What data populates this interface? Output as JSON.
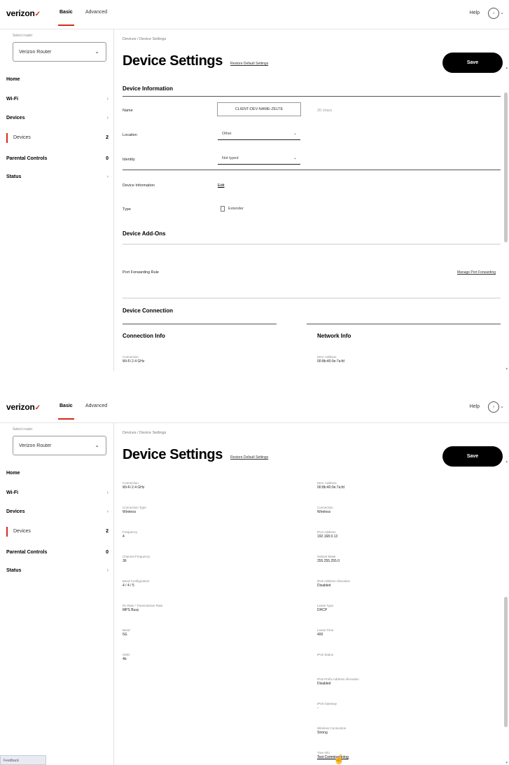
{
  "topbar": {
    "logo": "verizon",
    "logo_check": "✓",
    "tabs": [
      {
        "label": "Basic"
      },
      {
        "label": "Advanced"
      }
    ],
    "help": "Help",
    "avatar_icon": "person-circle-icon"
  },
  "sidebar": {
    "select_label": "Select router",
    "select_value": "Verizon Router",
    "items": [
      {
        "label": "Home",
        "right": ""
      },
      {
        "label": "Wi-Fi",
        "right": "›"
      },
      {
        "label": "Devices",
        "right": "›"
      },
      {
        "label": "Devices",
        "right": "2"
      },
      {
        "label": "Parental Controls",
        "right": "0"
      },
      {
        "label": "Status",
        "right": "›"
      }
    ]
  },
  "main": {
    "breadcrumb": "Devices  /  Device Settings",
    "title": "Device Settings",
    "restore_link": "Restore Default Settings",
    "save_label": "Save"
  },
  "device_info": {
    "heading": "Device Information",
    "name_label": "Name",
    "name_value": "CLIENT-DEV-NAME-ZELTE",
    "name_hint": "20 chars",
    "location_label": "Location",
    "location_value": "Other",
    "identity_label": "Identity",
    "identity_value": "Not typed",
    "device_info_label": "Device Information",
    "device_info_link": "Edit",
    "type_label": "Type",
    "type_check_label": "Extender"
  },
  "addons": {
    "heading": "Device Add-Ons",
    "port_forwarding_label": "Port Forwarding Rule",
    "manage_link": "Manage Port Forwarding"
  },
  "connection": {
    "heading": "Device Connection",
    "conn_info_heading": "Connection Info",
    "net_info_heading": "Network Info",
    "left_fields": [
      {
        "label": "Connection",
        "value": "Wi-Fi 2.4 GHz"
      },
      {
        "label": "Connection Type",
        "value": "Wireless"
      },
      {
        "label": "Frequency",
        "value": "4"
      },
      {
        "label": "Channel Frequency",
        "value": "36"
      },
      {
        "label": "Band Configuration",
        "value": "4 / 4 / 5"
      },
      {
        "label": "Rx Rate / Transmission Rate",
        "value": "MPS Busy"
      },
      {
        "label": "Band",
        "value": "5G"
      },
      {
        "label": "SSID",
        "value": "4b"
      }
    ],
    "right_fields": [
      {
        "label": "MAC Address",
        "value": "00:8b:40:0e:7a:fd"
      },
      {
        "label": "Connection",
        "value": "Wireless"
      },
      {
        "label": "IPv4 Address",
        "value": "192.168.0.13"
      },
      {
        "label": "Subnet Mask",
        "value": "255.255.255.0"
      },
      {
        "label": "IPv6 Address Allocation",
        "value": "Disabled"
      },
      {
        "label": "Lease Type",
        "value": "DHCP"
      },
      {
        "label": "Lease Time",
        "value": "400"
      },
      {
        "label": "IPv6 Status",
        "value": ""
      },
      {
        "label": "IPv6 Prefix Address Allocation",
        "value": "Disabled"
      },
      {
        "label": "IPv6 Gateway",
        "value": "-"
      },
      {
        "label": "Wireless Connection",
        "value": "Strong"
      },
      {
        "label": "Tree Info",
        "value": "Test Commissioning"
      }
    ]
  },
  "feedback_label": "Feedback"
}
